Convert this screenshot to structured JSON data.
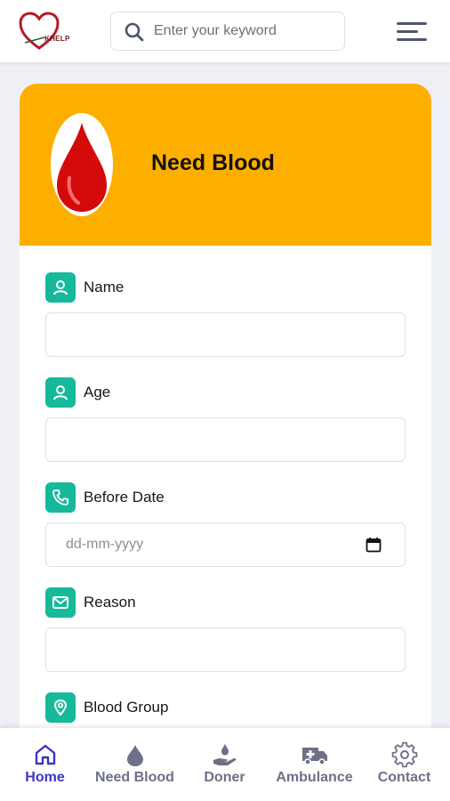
{
  "header": {
    "logo_text": "KHELP",
    "search": {
      "placeholder": "Enter your keyword",
      "value": ""
    }
  },
  "form": {
    "title": "Need Blood",
    "fields": [
      {
        "label": "Name",
        "icon": "user-icon",
        "placeholder": "",
        "value": ""
      },
      {
        "label": "Age",
        "icon": "user-icon",
        "placeholder": "",
        "value": ""
      },
      {
        "label": "Before Date",
        "icon": "phone-icon",
        "placeholder": "dd-mm-yyyy",
        "value": ""
      },
      {
        "label": "Reason",
        "icon": "envelope-icon",
        "placeholder": "",
        "value": ""
      },
      {
        "label": "Blood Group",
        "icon": "location-pin-icon",
        "placeholder": "",
        "value": ""
      }
    ]
  },
  "bottom_nav": [
    {
      "label": "Home",
      "icon": "home-icon",
      "active": true
    },
    {
      "label": "Need Blood",
      "icon": "blood-drop-icon",
      "active": false
    },
    {
      "label": "Doner",
      "icon": "donate-hand-icon",
      "active": false
    },
    {
      "label": "Ambulance",
      "icon": "ambulance-icon",
      "active": false
    },
    {
      "label": "Contact",
      "icon": "gear-icon",
      "active": false
    }
  ],
  "colors": {
    "accent": "#fdaf00",
    "badge": "#16b99a",
    "nav_active": "#3b36c4",
    "nav_inactive": "#6d7086",
    "page_bg": "#eef0f6"
  }
}
